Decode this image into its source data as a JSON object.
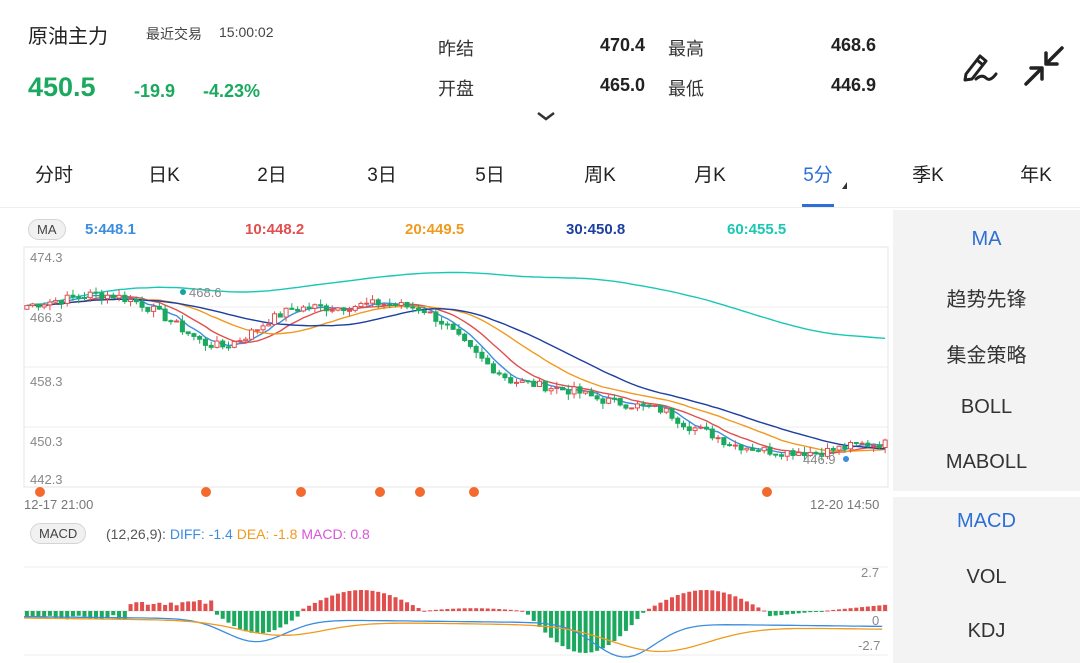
{
  "header": {
    "name": "原油主力",
    "last_trade_label": "最近交易",
    "last_trade_time": "15:00:02",
    "price": "450.5",
    "change": "-19.9",
    "change_pct": "-4.23%",
    "stats": [
      {
        "label": "昨结",
        "value": "470.4"
      },
      {
        "label": "最高",
        "value": "468.6"
      },
      {
        "label": "开盘",
        "value": "465.0"
      },
      {
        "label": "最低",
        "value": "446.9"
      }
    ],
    "edit_icon": "pen-icon",
    "shrink_icon": "collapse-arrows-icon"
  },
  "tabs": [
    "分时",
    "日K",
    "2日",
    "3日",
    "5日",
    "周K",
    "月K",
    "5分",
    "季K",
    "年K"
  ],
  "active_tab": "5分",
  "ma_panel": {
    "badge": "MA",
    "values": [
      {
        "label": "5:448.1",
        "color": "#3a8de0"
      },
      {
        "label": "10:448.2",
        "color": "#e14e4e"
      },
      {
        "label": "20:449.5",
        "color": "#f09a1e"
      },
      {
        "label": "30:450.8",
        "color": "#1d3fa0"
      },
      {
        "label": "60:455.5",
        "color": "#19c8b4"
      }
    ],
    "y_labels": [
      "474.3",
      "466.3",
      "458.3",
      "450.3",
      "442.3"
    ],
    "high_mark": "468.6",
    "low_mark": "446.9",
    "time_start": "12-17 21:00",
    "time_end": "12-20 14:50"
  },
  "macd_panel": {
    "badge": "MACD",
    "params": "(12,26,9):",
    "diff": "DIFF: -1.4",
    "dea": "DEA: -1.8",
    "macd": "MACD: 0.8",
    "y_labels": [
      "2.7",
      "0",
      "-2.7"
    ]
  },
  "sidebar": {
    "upper": [
      "MA",
      "趋势先锋",
      "集金策略",
      "BOLL",
      "MABOLL"
    ],
    "lower": [
      "MACD",
      "VOL",
      "KDJ"
    ],
    "active_upper": "MA",
    "active_lower": "MACD"
  },
  "chart_data": {
    "type": "candlestick",
    "y_range": [
      442.3,
      474.3
    ],
    "close_trend": [
      466.5,
      467.0,
      467.5,
      468.0,
      467.8,
      467.0,
      465.5,
      463.5,
      461.5,
      461.0,
      462.5,
      464.5,
      466.0,
      466.3,
      466.2,
      466.5,
      466.8,
      466.5,
      466.0,
      464.0,
      461.0,
      458.5,
      456.5,
      456.0,
      455.5,
      455.0,
      454.0,
      453.5,
      453.0,
      452.5,
      450.5,
      449.5,
      448.0,
      447.5,
      447.0,
      447.0,
      446.9,
      447.5,
      448.0,
      448.1
    ],
    "ma": {
      "5": 448.1,
      "10": 448.2,
      "20": 449.5,
      "30": 450.8,
      "60": 455.5
    },
    "high": 468.6,
    "low": 446.9,
    "macd": {
      "diff": -1.4,
      "dea": -1.8,
      "macd": 0.8,
      "y_range": [
        -2.7,
        2.7
      ]
    }
  }
}
